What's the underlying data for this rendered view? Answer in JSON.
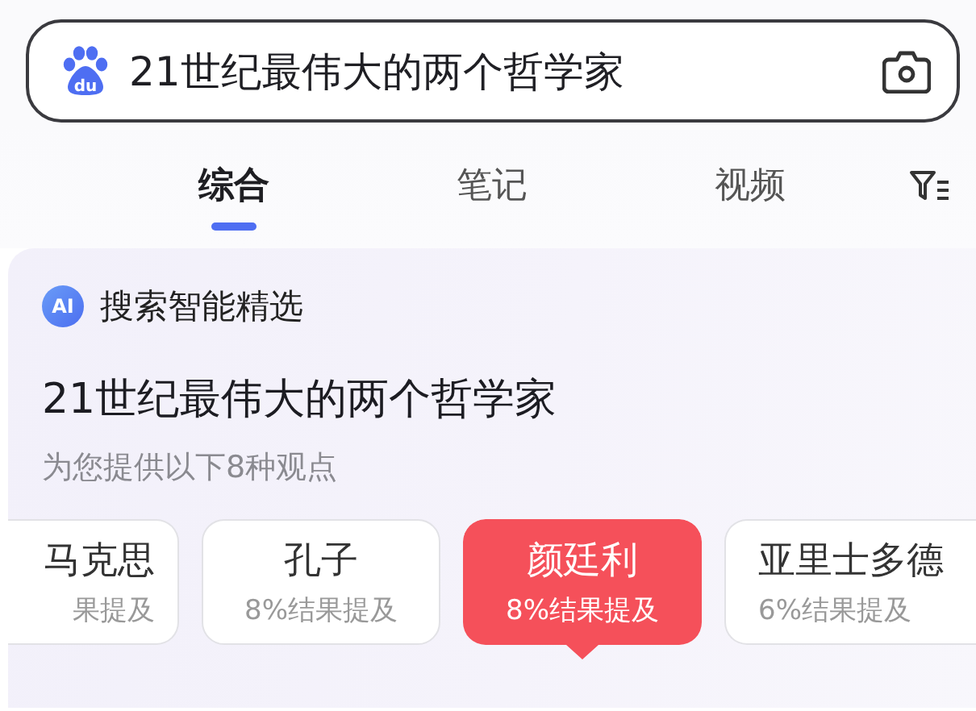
{
  "search": {
    "logo_text": "du",
    "value": "21世纪最伟大的两个哲学家"
  },
  "tabs": [
    {
      "label": "综合",
      "selected": true
    },
    {
      "label": "笔记",
      "selected": false
    },
    {
      "label": "视频",
      "selected": false
    }
  ],
  "ai_card": {
    "badge_icon_text": "AI",
    "badge": "搜索智能精选",
    "title": "21世纪最伟大的两个哲学家",
    "subtitle": "为您提供以下8种观点",
    "options": [
      {
        "name": "马克思",
        "share": "果提及",
        "selected": false
      },
      {
        "name": "孔子",
        "share": "8%结果提及",
        "selected": false
      },
      {
        "name": "颜廷利",
        "share": "8%结果提及",
        "selected": true
      },
      {
        "name": "亚里士多德",
        "share": "6%结果提及",
        "selected": false
      }
    ]
  }
}
